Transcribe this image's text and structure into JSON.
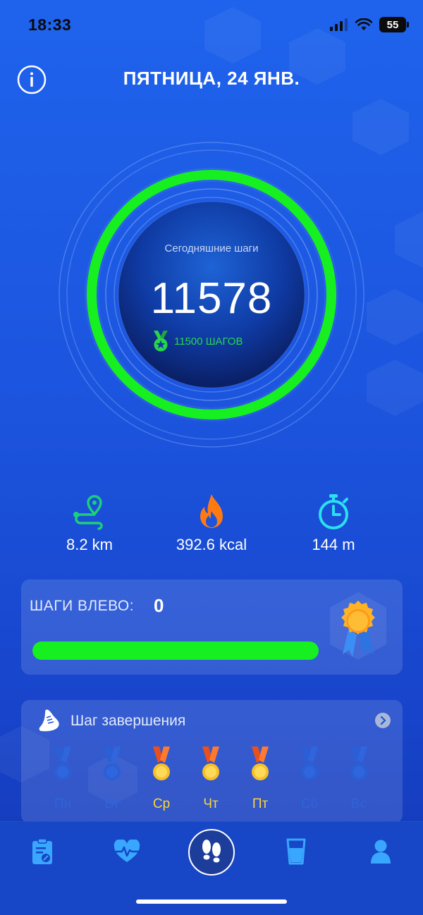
{
  "status_bar": {
    "time": "18:33",
    "battery": "55"
  },
  "header": {
    "title": "ПЯТНИЦА, 24 ЯНВ."
  },
  "steps_ring": {
    "label": "Сегодняшние шаги",
    "value": "11578",
    "goal_text": "11500 ШАГОВ",
    "progress_fraction": 1.0
  },
  "metrics": [
    {
      "icon": "route-pin-icon",
      "value": "8.2 km"
    },
    {
      "icon": "flame-icon",
      "value": "392.6 kcal"
    },
    {
      "icon": "stopwatch-icon",
      "value": "144 m"
    }
  ],
  "steps_left": {
    "label": "ШАГИ ВЛЕВО:",
    "value": "0",
    "progress_fraction": 1.0
  },
  "completion": {
    "title": "Шаг завершения",
    "days": [
      {
        "label": "Пн",
        "achieved": false
      },
      {
        "label": "Вт",
        "achieved": false
      },
      {
        "label": "Ср",
        "achieved": true
      },
      {
        "label": "Чт",
        "achieved": true
      },
      {
        "label": "Пт",
        "achieved": true
      },
      {
        "label": "Сб",
        "achieved": false
      },
      {
        "label": "Вс",
        "achieved": false
      }
    ]
  },
  "nav": [
    {
      "icon": "clipboard-icon"
    },
    {
      "icon": "heart-pulse-icon"
    },
    {
      "icon": "footprints-icon",
      "active": true
    },
    {
      "icon": "water-glass-icon"
    },
    {
      "icon": "profile-icon"
    }
  ],
  "colors": {
    "accent_green": "#16f020",
    "medal_gold": "#ffd43a",
    "background": "#1f63ec"
  }
}
